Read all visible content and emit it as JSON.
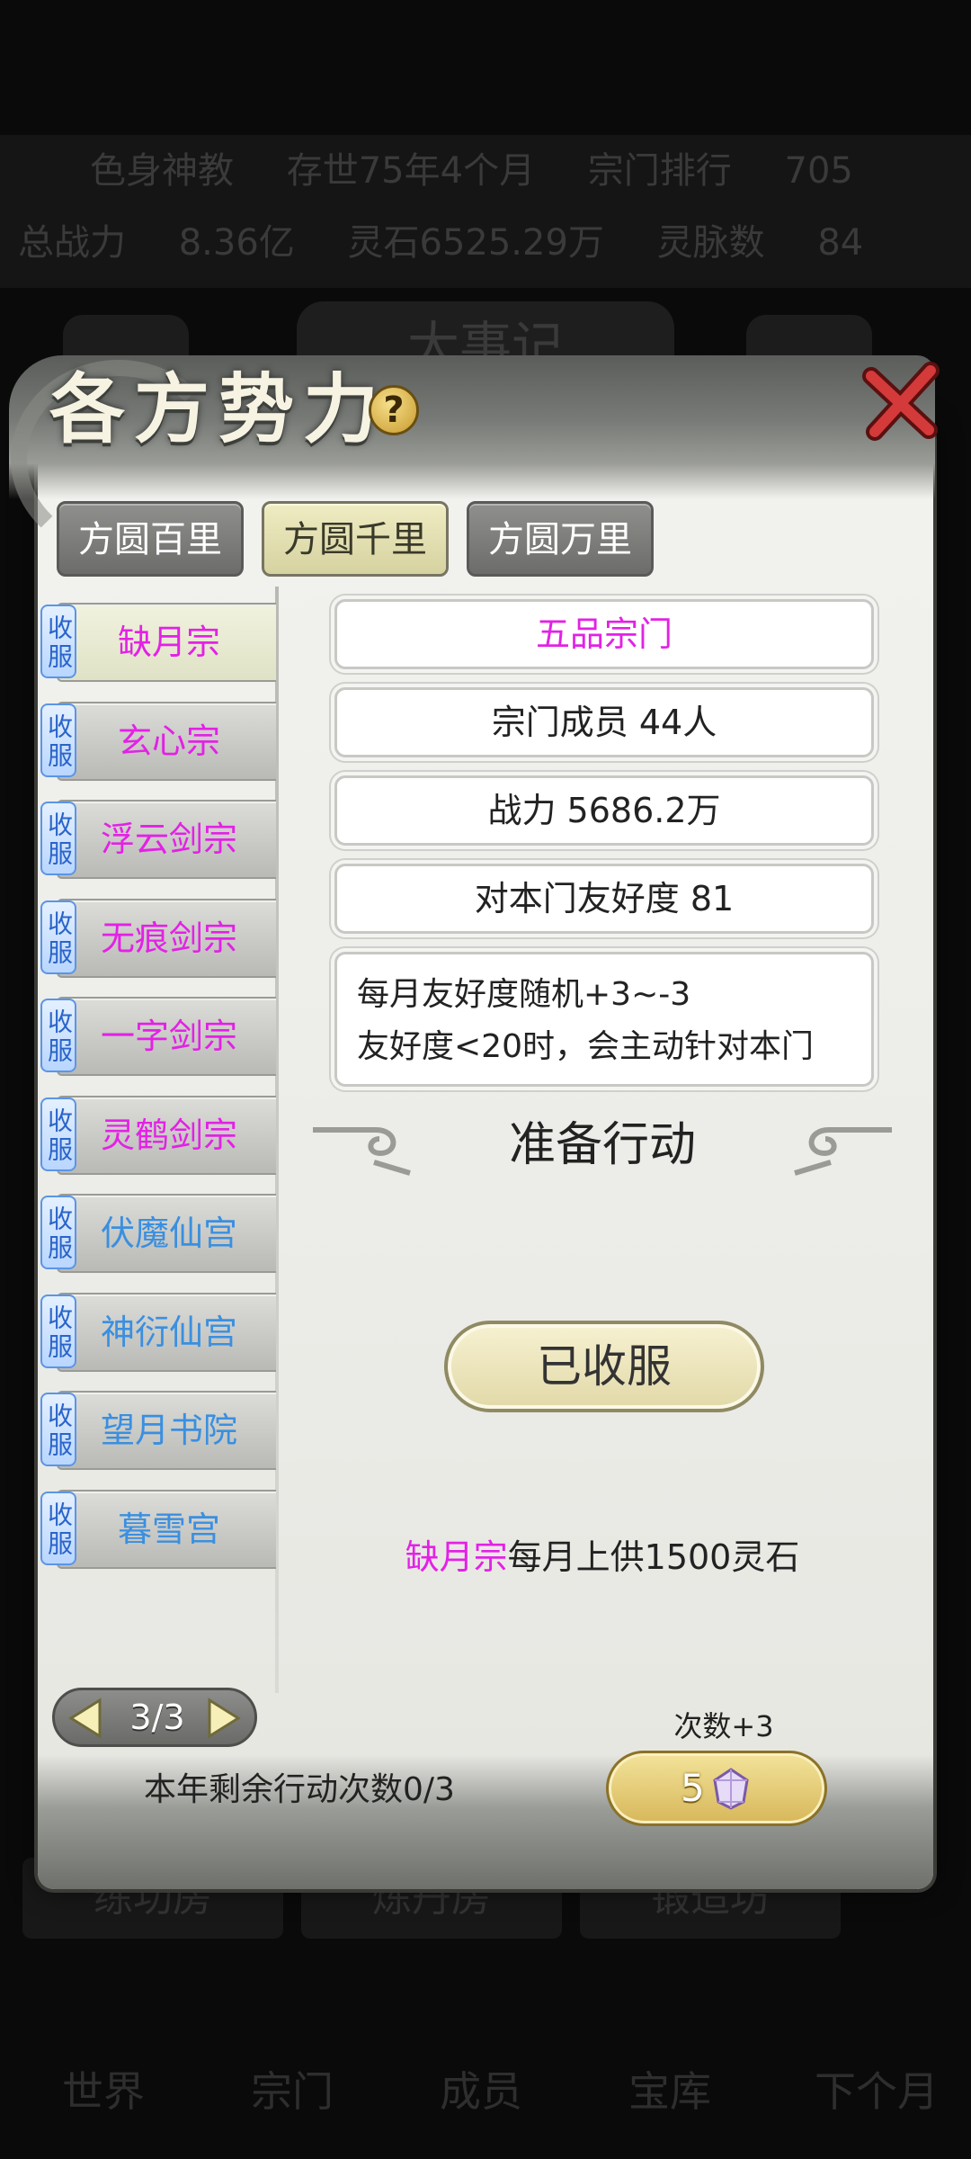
{
  "background": {
    "stats_row1": [
      "色身神教",
      "存世75年4个月",
      "宗门排行",
      "705"
    ],
    "stats_row2": [
      "总战力",
      "8.36亿",
      "灵石6525.29万",
      "灵脉数",
      "84"
    ],
    "title": "大事记",
    "menu": [
      "练功房",
      "炼丹房",
      "锻造坊"
    ],
    "nav": [
      "世界",
      "宗门",
      "成员",
      "宝库",
      "下个月"
    ]
  },
  "dialog": {
    "title": "各方势力",
    "help_icon": "?",
    "tabs": [
      {
        "label": "方圆百里",
        "active": false
      },
      {
        "label": "方圆千里",
        "active": true
      },
      {
        "label": "方圆万里",
        "active": false
      }
    ],
    "sects": [
      {
        "tag": "收服",
        "name": "缺月宗",
        "color": "#e321e6",
        "selected": true
      },
      {
        "tag": "收服",
        "name": "玄心宗",
        "color": "#e321e6"
      },
      {
        "tag": "收服",
        "name": "浮云剑宗",
        "color": "#e321e6"
      },
      {
        "tag": "收服",
        "name": "无痕剑宗",
        "color": "#e321e6"
      },
      {
        "tag": "收服",
        "name": "一字剑宗",
        "color": "#e321e6"
      },
      {
        "tag": "收服",
        "name": "灵鹤剑宗",
        "color": "#e321e6"
      },
      {
        "tag": "收服",
        "name": "伏魔仙宫",
        "color": "#3a8fe0"
      },
      {
        "tag": "收服",
        "name": "神衍仙宫",
        "color": "#3a8fe0"
      },
      {
        "tag": "收服",
        "name": "望月书院",
        "color": "#3a8fe0"
      },
      {
        "tag": "收服",
        "name": "暮雪宫",
        "color": "#3a8fe0"
      }
    ],
    "detail": {
      "rank": "五品宗门",
      "members": "宗门成员 44人",
      "power": "战力 5686.2万",
      "friendliness": "对本门友好度 81",
      "desc_line1": "每月友好度随机+3~-3",
      "desc_line2": "友好度<20时，会主动针对本门",
      "action_title": "准备行动",
      "claimed_button": "已收服",
      "tribute_sect": "缺月宗",
      "tribute_text": "每月上供1500灵石"
    },
    "pager": {
      "label": "3/3"
    },
    "remaining": "本年剩余行动次数0/3",
    "extra_count_label": "次数+3",
    "cost": "5",
    "colors": {
      "pink": "#e321e6",
      "blue": "#3a8fe0",
      "gold": "#d7b75a"
    }
  }
}
